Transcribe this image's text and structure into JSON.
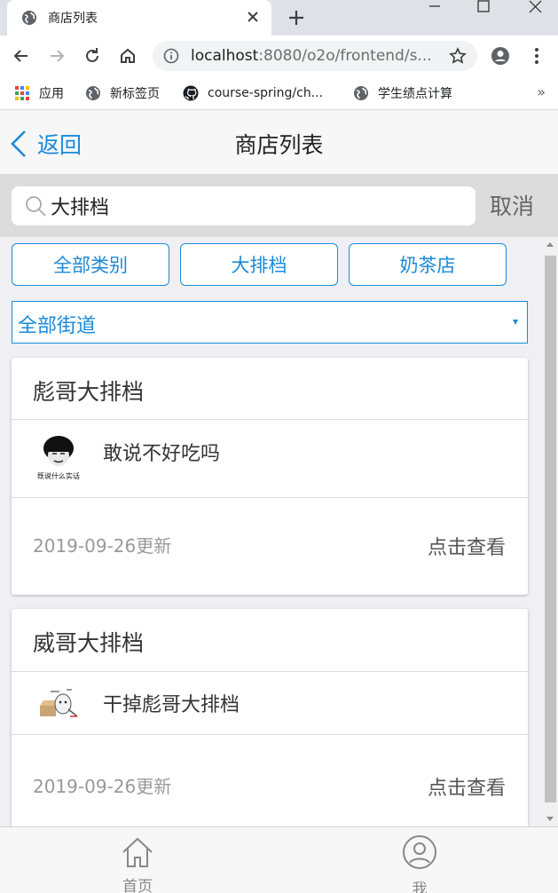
{
  "browser": {
    "tab_title": "商店列表",
    "url_host": "localhost",
    "url_rest": ":8080/o2o/frontend/s...",
    "bookmarks": [
      {
        "label": "应用",
        "icon": "apps-grid-icon"
      },
      {
        "label": "新标签页",
        "icon": "globe-icon"
      },
      {
        "label": "course-spring/ch...",
        "icon": "github-icon"
      },
      {
        "label": "学生绩点计算",
        "icon": "globe-icon"
      }
    ],
    "bookmarks_more": "»"
  },
  "page": {
    "nav": {
      "back_label": "返回",
      "title": "商店列表"
    },
    "search": {
      "value": "大排档",
      "cancel_label": "取消"
    },
    "categories": [
      "全部类别",
      "大排档",
      "奶茶店"
    ],
    "area": {
      "selected": "全部街道"
    },
    "shops": [
      {
        "name": "彪哥大排档",
        "desc": "敢说不好吃吗",
        "thumb_caption": "既说什么实话",
        "update": "2019-09-26更新",
        "action": "点击查看"
      },
      {
        "name": "威哥大排档",
        "desc": "干掉彪哥大排档",
        "update": "2019-09-26更新",
        "action": "点击查看"
      }
    ],
    "tabbar": {
      "home_label": "首页",
      "me_label": "我"
    },
    "colors": {
      "accent": "#1a8ad9",
      "nav_bg": "#f7f7f7",
      "search_bg": "#dcdcdc"
    }
  }
}
